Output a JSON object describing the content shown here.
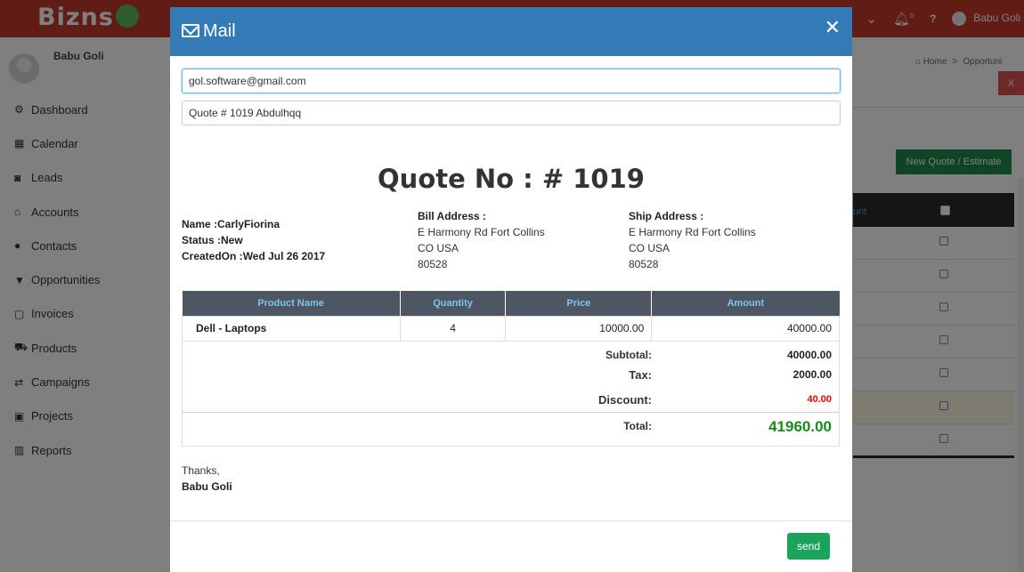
{
  "app": {
    "logo": "Bizns"
  },
  "topbar": {
    "user": "Babu Goli",
    "notif_count": "0",
    "help": "?"
  },
  "sidebar": {
    "username": "Babu Goli",
    "items": [
      {
        "label": "Dashboard",
        "icon": "dashboard-icon",
        "glyph": "⚙"
      },
      {
        "label": "Calendar",
        "icon": "calendar-icon",
        "glyph": "▦"
      },
      {
        "label": "Leads",
        "icon": "leads-icon",
        "glyph": "◙"
      },
      {
        "label": "Accounts",
        "icon": "bank-icon",
        "glyph": "⌂"
      },
      {
        "label": "Contacts",
        "icon": "user-icon",
        "glyph": "●"
      },
      {
        "label": "Opportunities",
        "icon": "filter-icon",
        "glyph": "▼"
      },
      {
        "label": "Invoices",
        "icon": "file-icon",
        "glyph": "▢"
      },
      {
        "label": "Products",
        "icon": "cart-icon",
        "glyph": "⛟"
      },
      {
        "label": "Campaigns",
        "icon": "exchange-icon",
        "glyph": "⇄"
      },
      {
        "label": "Projects",
        "icon": "briefcase-icon",
        "glyph": "▣"
      },
      {
        "label": "Reports",
        "icon": "bar-chart-icon",
        "glyph": "▥"
      }
    ]
  },
  "page": {
    "breadcrumb_home": "Home",
    "breadcrumb_current": "Opportuni",
    "close_label": "X",
    "new_quote_label": "New Quote / Estimate",
    "table_header_partial": "unt"
  },
  "modal": {
    "title": "Mail",
    "to_value": "gol.software@gmail.com",
    "subject_value": "Quote # 1019 Abdulhqq",
    "quote_title": "Quote No : # 1019",
    "customer": {
      "name_label": "Name :",
      "name": "CarlyFiorina",
      "status_label": "Status :",
      "status": "New",
      "created_label": "CreatedOn :",
      "created": "Wed Jul 26 2017"
    },
    "bill": {
      "heading": "Bill Address :",
      "line1": "E Harmony Rd Fort Collins",
      "line2": "CO USA",
      "line3": "80528"
    },
    "ship": {
      "heading": "Ship Address :",
      "line1": "E Harmony Rd Fort Collins",
      "line2": "CO USA",
      "line3": "80528"
    },
    "table": {
      "headers": [
        "Product Name",
        "Quantity",
        "Price",
        "Amount"
      ],
      "rows": [
        {
          "product": "Dell - Laptops",
          "quantity": "4",
          "price": "10000.00",
          "amount": "40000.00"
        }
      ]
    },
    "totals": {
      "subtotal_label": "Subtotal:",
      "subtotal": "40000.00",
      "tax_label": "Tax:",
      "tax": "2000.00",
      "discount_label": "Discount:",
      "discount": "40.00",
      "total_label": "Total:",
      "total": "41960.00"
    },
    "signature": {
      "thanks": "Thanks,",
      "name": "Babu Goli"
    },
    "send_label": "send"
  },
  "colors": {
    "topbar": "#c0392b",
    "modal_header": "#337ab7",
    "table_header": "#4e5563",
    "send_button": "#1aa35a",
    "discount": "#e00000",
    "total": "#1a8a1a"
  }
}
